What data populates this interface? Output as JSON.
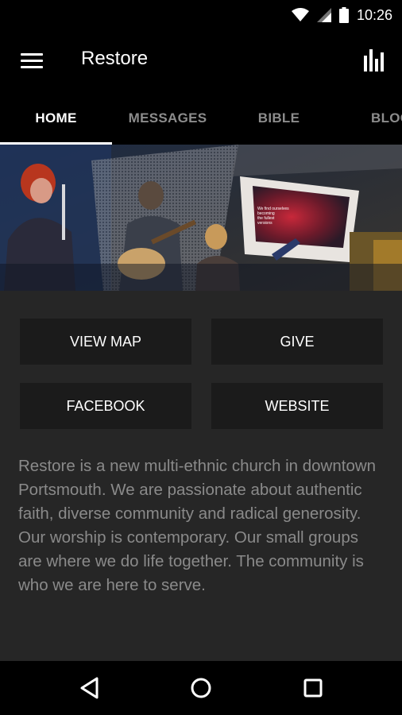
{
  "status_bar": {
    "time": "10:26",
    "icons": [
      "wifi-icon",
      "signal-icon",
      "battery-icon"
    ]
  },
  "app_bar": {
    "title": "Restore",
    "menu_icon": "hamburger-menu-icon",
    "action_icon": "bar-chart-icon"
  },
  "tabs": [
    {
      "label": "HOME",
      "active": true
    },
    {
      "label": "MESSAGES",
      "active": false
    },
    {
      "label": "BIBLE",
      "active": false
    },
    {
      "label": "BLOG",
      "active": false
    }
  ],
  "hero": {
    "slide_text": "We find ourselves\nbecoming\nthe fullest\nversions"
  },
  "buttons": {
    "view_map": "VIEW MAP",
    "give": "GIVE",
    "facebook": "FACEBOOK",
    "website": "WEBSITE"
  },
  "description": "Restore is a new multi-ethnic church in downtown Portsmouth. We are passionate about authentic faith, diverse community and radical generosity. Our worship is contemporary. Our small groups are where we do life together. The community is who we are here to serve.",
  "nav_bar": {
    "icons": [
      "back-icon",
      "home-icon",
      "recents-icon"
    ]
  },
  "colors": {
    "background": "#262626",
    "bar": "#000000",
    "button": "#1b1b1b",
    "text_muted": "#8a8a8a",
    "tab_inactive": "#8c8c8c"
  }
}
